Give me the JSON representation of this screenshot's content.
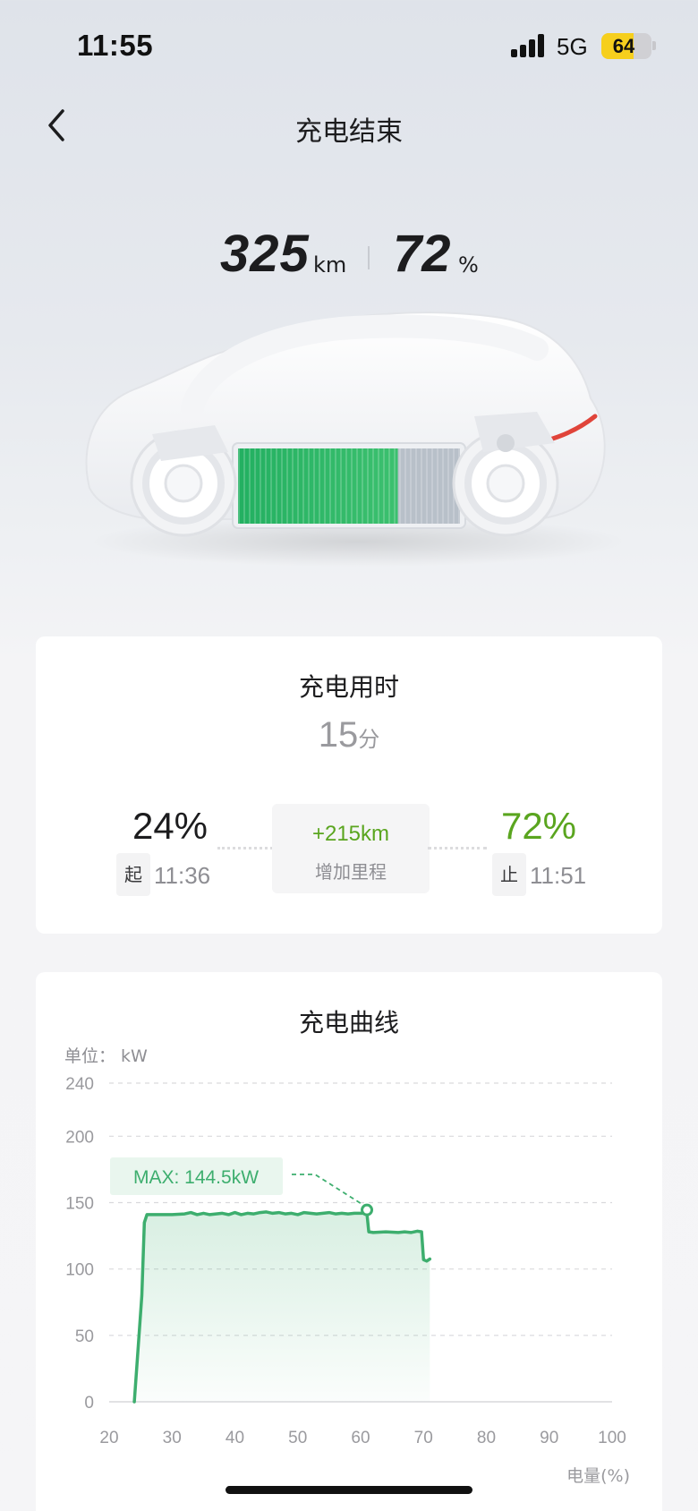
{
  "status_bar": {
    "time": "11:55",
    "network": "5G",
    "battery_level": "64",
    "battery_fraction": 0.64,
    "icons": [
      "signal-icon",
      "battery-icon"
    ]
  },
  "nav": {
    "back_icon": "chevron-left-icon",
    "title": "充电结束"
  },
  "summary": {
    "range_value": "325",
    "range_unit": "km",
    "soc_value": "72",
    "soc_unit": "%"
  },
  "car": {
    "battery_fill_fraction": 0.72,
    "battery_color": "#2fb866",
    "accent_color": "#e0443a"
  },
  "charge_time_card": {
    "title": "充电用时",
    "duration_value": "15",
    "duration_unit": "分",
    "start_percent": "24%",
    "start_tag": "起",
    "start_time": "11:36",
    "end_percent": "72%",
    "end_tag": "止",
    "end_time": "11:51",
    "added_range": "+215km",
    "added_range_label": "增加里程",
    "accent_color": "#5aa51f"
  },
  "chart_card": {
    "title": "充电曲线",
    "unit_label": "单位：  kW",
    "x_axis_label": "电量(%)",
    "max_label": "MAX: 144.5kW"
  },
  "chart_data": {
    "type": "area",
    "title": "充电曲线",
    "ylabel": "单位：  kW",
    "xlabel": "电量(%)",
    "xlim": [
      20,
      100
    ],
    "x_ticks": [
      20,
      30,
      40,
      50,
      60,
      70,
      80,
      90,
      100
    ],
    "y_ticks": [
      0,
      50,
      100,
      150,
      200,
      240
    ],
    "grid": true,
    "line_color": "#3dae6e",
    "max_annotation": {
      "label": "MAX: 144.5kW",
      "x": 61,
      "y": 144.5
    },
    "series": [
      {
        "x": [
          24,
          25.2,
          25.6,
          26,
          27,
          30,
          32,
          33,
          34,
          35,
          36,
          37,
          38,
          39,
          40,
          41,
          42,
          43,
          44,
          45,
          46,
          47,
          48,
          49,
          50,
          51,
          52,
          53,
          54,
          55,
          56,
          57,
          58,
          59,
          60,
          61,
          61.3,
          62,
          64,
          66,
          67,
          68,
          69,
          69.7,
          70,
          70.5,
          71
        ],
        "y": [
          0,
          80,
          135,
          141,
          141,
          141,
          141.5,
          142.5,
          141,
          142,
          141,
          141.5,
          142,
          141,
          142.5,
          141,
          142,
          141.5,
          142.5,
          143,
          142,
          142.5,
          141.5,
          142,
          141,
          142.5,
          142,
          141.5,
          142,
          142.5,
          141.5,
          142,
          141.5,
          142,
          142,
          142,
          128,
          127.5,
          128,
          127.5,
          128,
          127.5,
          128.5,
          128,
          107,
          106,
          107.5
        ]
      }
    ]
  }
}
